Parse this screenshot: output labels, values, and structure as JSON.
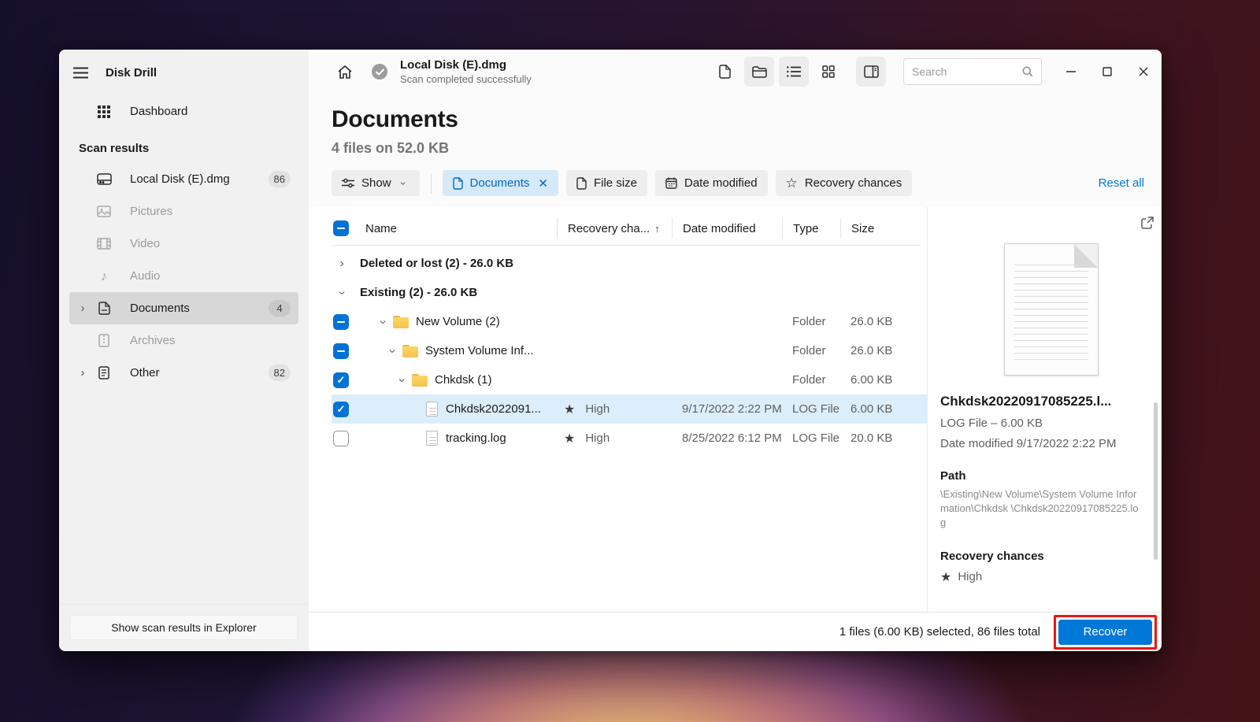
{
  "app": {
    "name": "Disk Drill"
  },
  "colors": {
    "accent": "#0078d7",
    "link": "#0078d4",
    "selected_row": "#dceefb",
    "annotation": "#ed1515",
    "chip_active_bg": "#d6e9f9"
  },
  "icons": {
    "chevron": "›",
    "chevron_down_label": "⌄",
    "sort_up": "↑",
    "star": "★",
    "star_outline": "☆",
    "music_note": "♪",
    "close_x": "✕"
  },
  "sidebar": {
    "title": "Disk Drill",
    "dashboard_label": "Dashboard",
    "section_label": "Scan results",
    "items": [
      {
        "label": "Local Disk (E).dmg",
        "badge": "86",
        "icon": "hard-drive",
        "state": "enabled"
      },
      {
        "label": "Pictures",
        "badge": "",
        "icon": "image",
        "state": "disabled"
      },
      {
        "label": "Video",
        "badge": "",
        "icon": "film",
        "state": "disabled"
      },
      {
        "label": "Audio",
        "badge": "",
        "icon": "music-note",
        "state": "disabled"
      },
      {
        "label": "Documents",
        "badge": "4",
        "icon": "document",
        "state": "selected"
      },
      {
        "label": "Archives",
        "badge": "",
        "icon": "zip-file",
        "state": "disabled"
      },
      {
        "label": "Other",
        "badge": "82",
        "icon": "document-lines",
        "state": "enabled"
      }
    ],
    "bottom_button": "Show scan results in Explorer"
  },
  "titlebar": {
    "scan_title": "Local Disk (E).dmg",
    "scan_subtitle": "Scan completed successfully",
    "search_placeholder": "Search"
  },
  "page": {
    "title": "Documents",
    "subtitle": "4 files on 52.0 KB"
  },
  "filters": {
    "show_label": "Show",
    "chips": [
      {
        "label": "Documents",
        "icon": "document",
        "active": true,
        "closable": true
      },
      {
        "label": "File size",
        "icon": "document",
        "active": false
      },
      {
        "label": "Date modified",
        "icon": "calendar",
        "active": false
      },
      {
        "label": "Recovery chances",
        "icon": "star",
        "active": false
      }
    ],
    "reset_all": "Reset all"
  },
  "table": {
    "columns": {
      "name": "Name",
      "recovery": "Recovery cha...",
      "date": "Date modified",
      "type": "Type",
      "size": "Size"
    },
    "sort": {
      "column": "recovery",
      "direction": "ascending"
    },
    "rows": [
      {
        "kind": "group",
        "name": "Deleted or lost (2) - 26.0 KB",
        "expanded": false
      },
      {
        "kind": "group",
        "name": "Existing (2) - 26.0 KB",
        "expanded": true
      },
      {
        "kind": "folder",
        "name": "New Volume (2)",
        "checkbox": "indeterminate",
        "type": "Folder",
        "size": "26.0 KB"
      },
      {
        "kind": "folder",
        "name": "System Volume Inf...",
        "checkbox": "indeterminate",
        "type": "Folder",
        "size": "26.0 KB"
      },
      {
        "kind": "folder",
        "name": "Chkdsk (1)",
        "checkbox": "checked",
        "type": "Folder",
        "size": "6.00 KB"
      },
      {
        "kind": "file",
        "name": "Chkdsk2022091...",
        "checkbox": "checked",
        "selected": true,
        "recovery": "High",
        "date": "9/17/2022 2:22 PM",
        "type": "LOG File",
        "size": "6.00 KB"
      },
      {
        "kind": "file",
        "name": "tracking.log",
        "checkbox": "unchecked",
        "selected": false,
        "recovery": "High",
        "date": "8/25/2022 6:12 PM",
        "type": "LOG File",
        "size": "20.0 KB"
      }
    ]
  },
  "details": {
    "filename": "Chkdsk20220917085225.l...",
    "meta_line1": "LOG File – 6.00 KB",
    "meta_line2": "Date modified 9/17/2022 2:22 PM",
    "path_label": "Path",
    "path_value": "\\Existing\\New Volume\\System Volume Information\\Chkdsk \\Chkdsk20220917085225.log",
    "recovery_label": "Recovery chances",
    "recovery_value": "High"
  },
  "footer": {
    "status": "1 files (6.00 KB) selected, 86 files total",
    "recover_label": "Recover"
  }
}
